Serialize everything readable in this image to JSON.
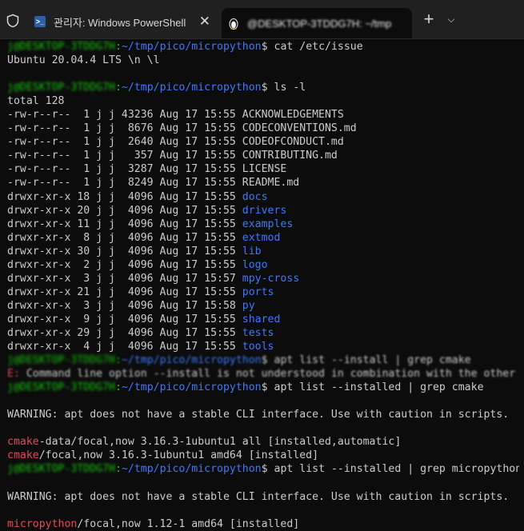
{
  "tabs": [
    {
      "title": "관리자: Windows PowerShell",
      "icon": "powershell-icon"
    },
    {
      "title": "@DESKTOP-3TDDG7H: ~/tmp",
      "icon": "linux-penguin-icon"
    }
  ],
  "new_tab_label": "+",
  "dropdown_label": "⌵",
  "prompt": {
    "user_host": "j@DESKTOP-3TDDG7H",
    "path": "~/tmp/pico/micropython",
    "symbol": "$"
  },
  "lines": [
    {
      "kind": "prompt",
      "cmd": "cat /etc/issue"
    },
    {
      "kind": "text",
      "text": "Ubuntu 20.04.4 LTS \\n \\l"
    },
    {
      "kind": "blank"
    },
    {
      "kind": "prompt",
      "cmd": "ls -l"
    },
    {
      "kind": "text",
      "text": "total 128"
    },
    {
      "kind": "ls",
      "meta": "-rw-r--r--  1 j j 43236 Aug 17 15:55 ",
      "name": "ACKNOWLEDGEMENTS",
      "dir": false
    },
    {
      "kind": "ls",
      "meta": "-rw-r--r--  1 j j  8676 Aug 17 15:55 ",
      "name": "CODECONVENTIONS.md",
      "dir": false
    },
    {
      "kind": "ls",
      "meta": "-rw-r--r--  1 j j  2640 Aug 17 15:55 ",
      "name": "CODEOFCONDUCT.md",
      "dir": false
    },
    {
      "kind": "ls",
      "meta": "-rw-r--r--  1 j j   357 Aug 17 15:55 ",
      "name": "CONTRIBUTING.md",
      "dir": false
    },
    {
      "kind": "ls",
      "meta": "-rw-r--r--  1 j j  3287 Aug 17 15:55 ",
      "name": "LICENSE",
      "dir": false
    },
    {
      "kind": "ls",
      "meta": "-rw-r--r--  1 j j  8249 Aug 17 15:55 ",
      "name": "README.md",
      "dir": false
    },
    {
      "kind": "ls",
      "meta": "drwxr-xr-x 18 j j  4096 Aug 17 15:55 ",
      "name": "docs",
      "dir": true
    },
    {
      "kind": "ls",
      "meta": "drwxr-xr-x 20 j j  4096 Aug 17 15:55 ",
      "name": "drivers",
      "dir": true
    },
    {
      "kind": "ls",
      "meta": "drwxr-xr-x 11 j j  4096 Aug 17 15:55 ",
      "name": "examples",
      "dir": true
    },
    {
      "kind": "ls",
      "meta": "drwxr-xr-x  8 j j  4096 Aug 17 15:55 ",
      "name": "extmod",
      "dir": true
    },
    {
      "kind": "ls",
      "meta": "drwxr-xr-x 30 j j  4096 Aug 17 15:55 ",
      "name": "lib",
      "dir": true
    },
    {
      "kind": "ls",
      "meta": "drwxr-xr-x  2 j j  4096 Aug 17 15:55 ",
      "name": "logo",
      "dir": true
    },
    {
      "kind": "ls",
      "meta": "drwxr-xr-x  3 j j  4096 Aug 17 15:57 ",
      "name": "mpy-cross",
      "dir": true
    },
    {
      "kind": "ls",
      "meta": "drwxr-xr-x 21 j j  4096 Aug 17 15:55 ",
      "name": "ports",
      "dir": true
    },
    {
      "kind": "ls",
      "meta": "drwxr-xr-x  3 j j  4096 Aug 17 15:58 ",
      "name": "py",
      "dir": true
    },
    {
      "kind": "ls",
      "meta": "drwxr-xr-x  9 j j  4096 Aug 17 15:55 ",
      "name": "shared",
      "dir": true
    },
    {
      "kind": "ls",
      "meta": "drwxr-xr-x 29 j j  4096 Aug 17 15:55 ",
      "name": "tests",
      "dir": true
    },
    {
      "kind": "ls",
      "meta": "drwxr-xr-x  4 j j  4096 Aug 17 15:55 ",
      "name": "tools",
      "dir": true
    },
    {
      "kind": "prompt-blurred",
      "cmd": "apt list --install | grep cmake"
    },
    {
      "kind": "error-blurred",
      "prefix": "E:",
      "text": " Command line option --install is not understood in combination with the other options"
    },
    {
      "kind": "prompt",
      "cmd": "apt list --installed | grep cmake"
    },
    {
      "kind": "blank"
    },
    {
      "kind": "text",
      "text": "WARNING: apt does not have a stable CLI interface. Use with caution in scripts."
    },
    {
      "kind": "blank"
    },
    {
      "kind": "match",
      "hit": "cmake",
      "rest": "-data/focal,now 3.16.3-1ubuntu1 all [installed,automatic]"
    },
    {
      "kind": "match",
      "hit": "cmake",
      "rest": "/focal,now 3.16.3-1ubuntu1 amd64 [installed]"
    },
    {
      "kind": "prompt",
      "cmd": "apt list --installed | grep micropython"
    },
    {
      "kind": "blank"
    },
    {
      "kind": "text",
      "text": "WARNING: apt does not have a stable CLI interface. Use with caution in scripts."
    },
    {
      "kind": "blank"
    },
    {
      "kind": "match",
      "hit": "micropython",
      "rest": "/focal,now 1.12-1 amd64 [installed]"
    }
  ],
  "colors": {
    "background": "#0c0c0c",
    "text": "#cccccc",
    "prompt_user": "#16c60c",
    "prompt_path": "#3b78ff",
    "directory": "#3b78ff",
    "grep_match": "#e74856"
  }
}
